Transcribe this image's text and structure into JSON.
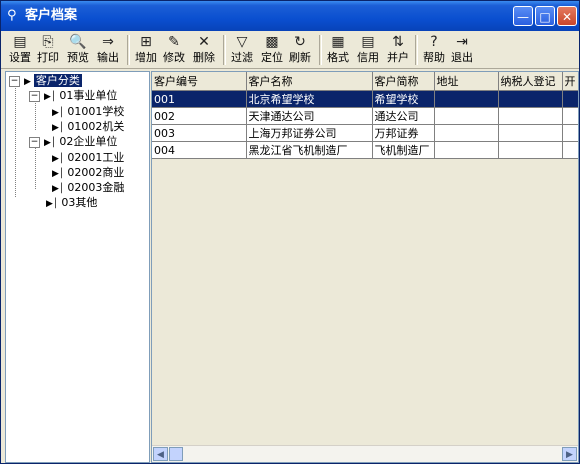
{
  "window": {
    "title": "客户档案",
    "icon": "search-icon"
  },
  "toolbar": {
    "items": [
      {
        "label": "设置",
        "icon": "setup-icon"
      },
      {
        "label": "打印",
        "icon": "printer-icon"
      },
      {
        "label": "预览",
        "icon": "preview-icon"
      },
      {
        "label": "输出",
        "icon": "export-icon"
      },
      {
        "label": "增加",
        "icon": "add-icon"
      },
      {
        "label": "修改",
        "icon": "edit-icon"
      },
      {
        "label": "删除",
        "icon": "delete-icon"
      },
      {
        "label": "过滤",
        "icon": "filter-icon"
      },
      {
        "label": "定位",
        "icon": "locate-icon"
      },
      {
        "label": "刷新",
        "icon": "refresh-icon"
      },
      {
        "label": "格式",
        "icon": "format-icon"
      },
      {
        "label": "信用",
        "icon": "credit-icon"
      },
      {
        "label": "并户",
        "icon": "merge-icon"
      },
      {
        "label": "帮助",
        "icon": "help-icon"
      },
      {
        "label": "退出",
        "icon": "exit-icon"
      }
    ]
  },
  "tree": {
    "root": "客户分类",
    "nodes": [
      {
        "label": "01事业单位",
        "children": [
          "01001学校",
          "01002机关"
        ]
      },
      {
        "label": "02企业单位",
        "children": [
          "02001工业",
          "02002商业",
          "02003金融"
        ]
      },
      {
        "label": "03其他",
        "children": []
      }
    ]
  },
  "table": {
    "columns": [
      "客户编号",
      "客户名称",
      "客户简称",
      "地址",
      "纳税人登记",
      "开"
    ],
    "rows": [
      [
        "001",
        "北京希望学校",
        "希望学校",
        "",
        ""
      ],
      [
        "002",
        "天津通达公司",
        "通达公司",
        "",
        ""
      ],
      [
        "003",
        "上海万邦证券公司",
        "万邦证券",
        "",
        ""
      ],
      [
        "004",
        "黑龙江省飞机制造厂",
        "飞机制造厂",
        "",
        ""
      ]
    ],
    "selected_row": 0
  },
  "colors": {
    "title_bar": "#0a4fd0",
    "selection": "#0a246a"
  }
}
